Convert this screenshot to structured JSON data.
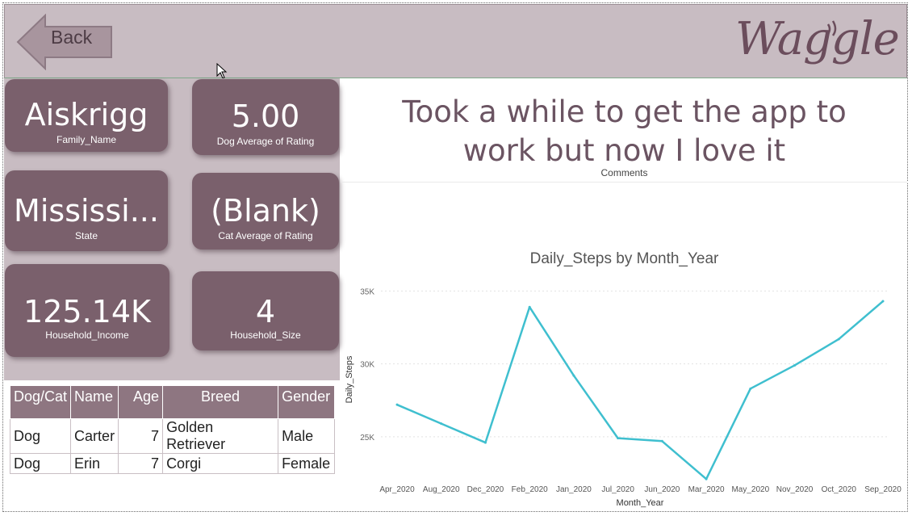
{
  "header": {
    "back_label": "Back",
    "logo_text": "Waggle"
  },
  "cards": [
    {
      "value": "Aiskrigg",
      "label": "Family_Name"
    },
    {
      "value": "5.00",
      "label": "Dog Average of Rating"
    },
    {
      "value": "Mississi...",
      "label": "State"
    },
    {
      "value": "(Blank)",
      "label": "Cat Average of Rating"
    },
    {
      "value": "125.14K",
      "label": "Household_Income"
    },
    {
      "value": "4",
      "label": "Household_Size"
    }
  ],
  "pets_table": {
    "headers": [
      "Dog/Cat",
      "Name",
      "Age",
      "Breed",
      "Gender"
    ],
    "rows": [
      [
        "Dog",
        "Carter",
        "7",
        "Golden Retriever",
        "Male"
      ],
      [
        "Dog",
        "Erin",
        "7",
        "Corgi",
        "Female"
      ]
    ]
  },
  "comment": {
    "line1": "Took a while to get the app to",
    "line2": "work but now I love it",
    "label": "Comments"
  },
  "colors": {
    "header_bg": "#c8bcc2",
    "card_bg": "#7a606c",
    "line": "#3fbfcf",
    "accent_text": "#6b5462"
  },
  "chart_data": {
    "type": "line",
    "title": "Daily_Steps by Month_Year",
    "xlabel": "Month_Year",
    "ylabel": "Daily_Steps",
    "categories": [
      "Apr_2020",
      "Aug_2020",
      "Dec_2020",
      "Feb_2020",
      "Jan_2020",
      "Jul_2020",
      "Jun_2020",
      "Mar_2020",
      "May_2020",
      "Nov_2020",
      "Oct_2020",
      "Sep_2020"
    ],
    "series": [
      {
        "values": [
          27200,
          25900,
          24600,
          33900,
          29200,
          24900,
          24700,
          22100,
          28300,
          29900,
          31700,
          34300
        ]
      }
    ],
    "yticks": [
      25000,
      30000,
      35000
    ],
    "ytick_labels": [
      "25K",
      "30K",
      "35K"
    ],
    "ylim": [
      22000,
      35300
    ],
    "grid": true
  }
}
